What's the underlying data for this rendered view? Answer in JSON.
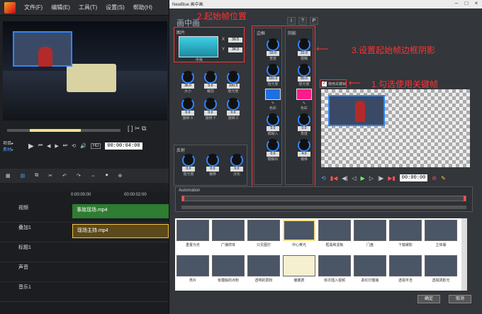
{
  "menu": {
    "file": "文件(F)",
    "edit": "编辑(E)",
    "tools": "工具(T)",
    "settings": "设置(S)",
    "help": "帮助(H)"
  },
  "left": {
    "project_label": "项目▸",
    "clip_label": "素材▸",
    "hd": "HD",
    "timecode": "00:00:04:00"
  },
  "tracks": [
    {
      "name": "视频",
      "clip": "事故现场.mp4",
      "clip_color": "#2e7d32"
    },
    {
      "name": "叠加1",
      "clip": "现场主持.mp4",
      "clip_color": "#5c4a1a"
    },
    {
      "name": "标题1",
      "clip": ""
    },
    {
      "name": "声音",
      "clip": ""
    },
    {
      "name": "音乐1",
      "clip": ""
    }
  ],
  "ruler": {
    "t0": "0:00:00:00",
    "t1": "00:00:02:00"
  },
  "dialog": {
    "window_title": "NewBlue 画中画",
    "title": "画中画",
    "icons": [
      "i",
      "?",
      "P"
    ],
    "picture": {
      "header": "图片",
      "x_label": "X",
      "x": "39.5",
      "y_label": "Y",
      "y": "34.9",
      "center": "中央"
    },
    "knobs_left": [
      {
        "v": "36.0",
        "l": "大小"
      },
      {
        "v": "0.0",
        "l": "裁剪"
      },
      {
        "v": "100.0",
        "l": "阻光度"
      },
      {
        "v": "0.0",
        "l": "旋转 X"
      },
      {
        "v": "0.0",
        "l": "旋转 Y"
      },
      {
        "v": "0.0",
        "l": "旋转 Z"
      }
    ],
    "reflect": {
      "header": "反射",
      "knobs": [
        {
          "v": "0.0",
          "l": "阻光度"
        },
        {
          "v": "0.0",
          "l": "偏移"
        },
        {
          "v": "0.0",
          "l": "淡化"
        }
      ]
    },
    "border": {
      "header": "边框",
      "knobs": [
        {
          "v": "33.0",
          "l": "宽度"
        },
        {
          "v": "100.0",
          "l": "阻光度"
        },
        {
          "v": "0.0",
          "l": "模糊入"
        },
        {
          "v": "0.0",
          "l": "模糊出"
        }
      ],
      "color_label": "色彩",
      "color": "#1e6fe0"
    },
    "shadow": {
      "header": "阴影",
      "knobs": [
        {
          "v": "22.0",
          "l": "模糊"
        },
        {
          "v": "80.0",
          "l": "阻光度"
        },
        {
          "v": "0.0",
          "l": "角度"
        },
        {
          "v": "4.0",
          "l": "偏移"
        }
      ],
      "color_label": "色彩",
      "color": "#ff1a8c"
    },
    "keyframe_label": "使用关键帧",
    "keyframe_checked": true,
    "timecode": "00:00:00",
    "automation_label": "Automation",
    "ok": "确定",
    "cancel": "取消",
    "presets_row1": [
      "重置为无",
      "广播样体",
      "只见图打",
      "中心黄光",
      "框黑和滤板",
      "门盘",
      "下载缓影",
      "立体版"
    ],
    "presets_row2": [
      "男片",
      "有模版的点粉",
      "透明的层粉",
      "偏量费",
      "依次插入视频",
      "素红灯模版",
      "透视平吉",
      "透视阴影光"
    ]
  },
  "annotations": {
    "a1": "1.勾选使用关键帧",
    "a2": "2.起始帧位置",
    "a3": "3.设置起始帧边框阴影"
  }
}
